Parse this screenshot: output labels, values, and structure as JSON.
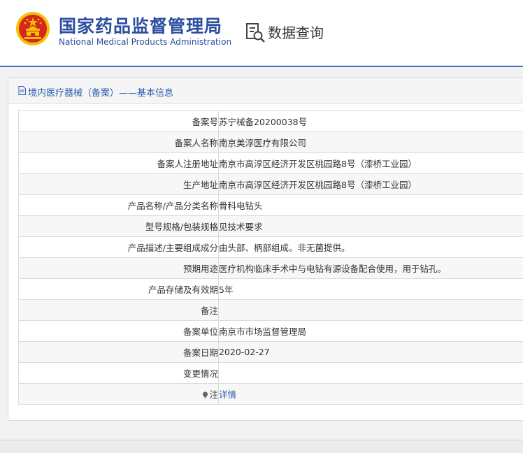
{
  "header": {
    "org_name_cn": "国家药品监督管理局",
    "org_name_en": "National Medical Products Administration",
    "query_title": "数据查询",
    "emblem_icon": "national-emblem-icon",
    "query_icon": "data-query-icon"
  },
  "panel": {
    "title": "境内医疗器械（备案）——基本信息",
    "title_icon": "document-icon"
  },
  "rows": [
    {
      "label": "备案号",
      "value": "苏宁械备20200038号"
    },
    {
      "label": "备案人名称",
      "value": "南京美淳医疗有限公司"
    },
    {
      "label": "备案人注册地址",
      "value": "南京市高淳区经济开发区桃园路8号（漆桥工业园）"
    },
    {
      "label": "生产地址",
      "value": "南京市高淳区经济开发区桃园路8号（漆桥工业园）"
    },
    {
      "label": "产品名称/产品分类名称",
      "value": "骨科电钻头"
    },
    {
      "label": "型号规格/包装规格",
      "value": "见技术要求"
    },
    {
      "label": "产品描述/主要组成成分",
      "value": "由头部、柄部组成。非无菌提供。"
    },
    {
      "label": "预期用途",
      "value": "医疗机构临床手术中与电钻有源设备配合使用，用于钻孔。"
    },
    {
      "label": "产品存储及有效期",
      "value": "5年"
    },
    {
      "label": "备注",
      "value": ""
    },
    {
      "label": "备案单位",
      "value": "南京市市场监督管理局"
    },
    {
      "label": "备案日期",
      "value": "2020-02-27"
    },
    {
      "label": "变更情况",
      "value": ""
    },
    {
      "label": "注",
      "value": "详情",
      "label_icon": "pin-icon"
    }
  ],
  "colors": {
    "brand_blue": "#2d4ea0",
    "link_blue": "#2a5db0",
    "header_line": "#3a6fc4",
    "emblem_red": "#d7261e",
    "emblem_gold": "#f2c200"
  }
}
